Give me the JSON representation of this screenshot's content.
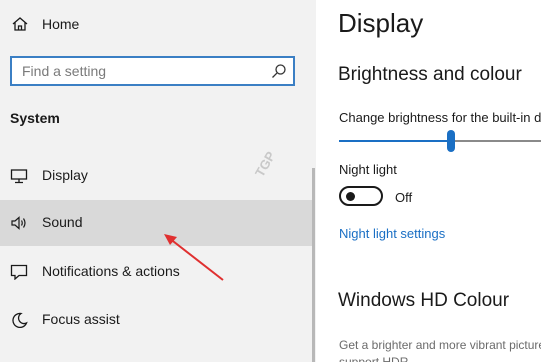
{
  "sidebar": {
    "home_label": "Home",
    "search": {
      "placeholder": "Find a setting"
    },
    "section_title": "System",
    "items": [
      {
        "label": "Display",
        "icon": "monitor-icon"
      },
      {
        "label": "Sound",
        "icon": "speaker-icon",
        "selected": true
      },
      {
        "label": "Notifications & actions",
        "icon": "notification-icon"
      },
      {
        "label": "Focus assist",
        "icon": "moon-icon"
      }
    ],
    "watermark": "TGP"
  },
  "content": {
    "page_title": "Display",
    "brightness_heading": "Brightness and colour",
    "brightness_label": "Change brightness for the built-in display",
    "brightness_level": 0.49,
    "night_light_label": "Night light",
    "night_light_state": "Off",
    "night_light_settings_link": "Night light settings",
    "hd_heading": "Windows HD Colour",
    "hd_description_1": "Get a brighter and more vibrant picture",
    "hd_description_2": "support HDR"
  },
  "colors": {
    "accent": "#1a6fc4",
    "annotation_arrow": "#e03030",
    "sidebar_bg": "#f2f2f2",
    "selected_bg": "#d9d9d9"
  }
}
